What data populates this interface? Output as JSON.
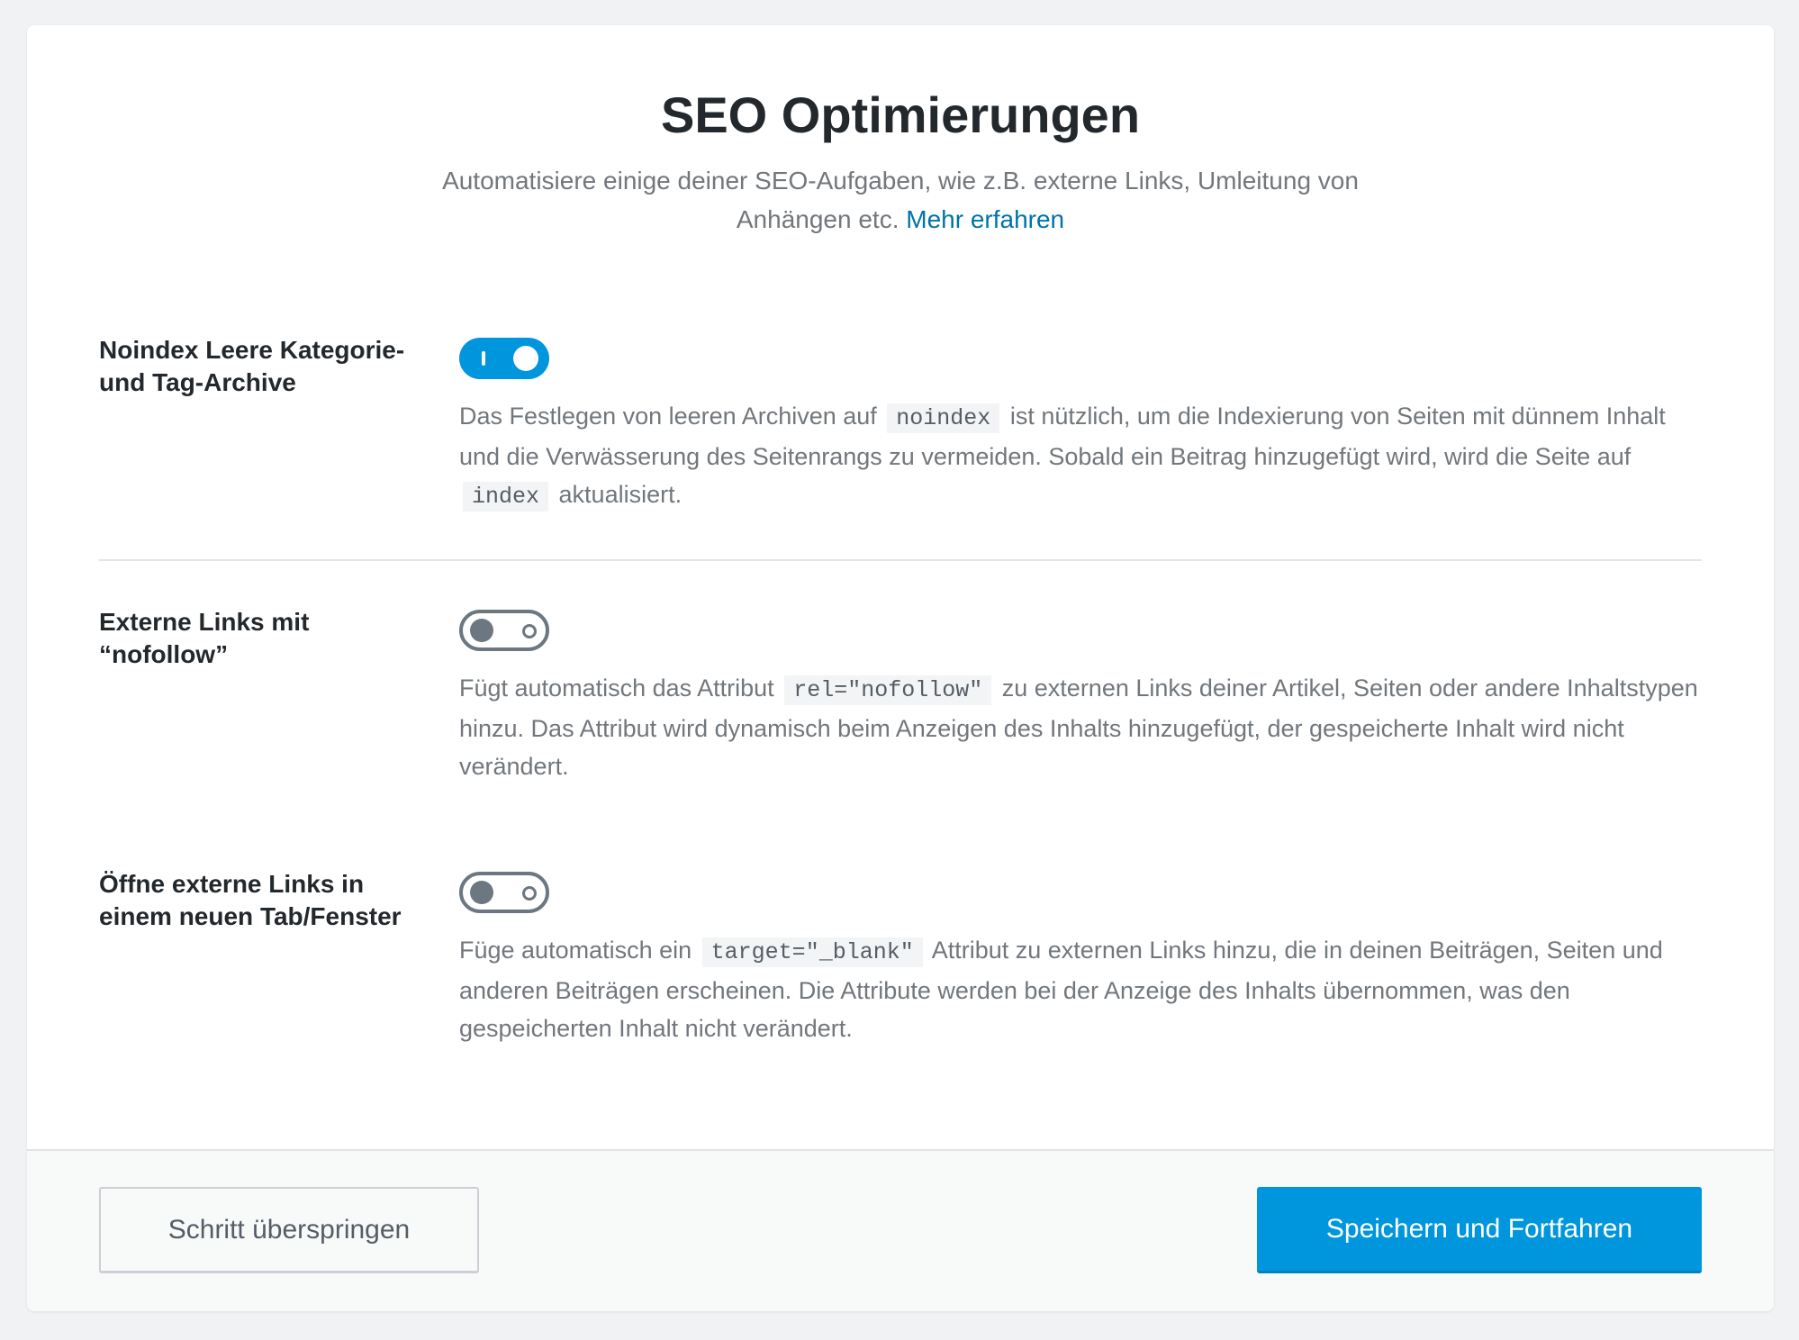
{
  "header": {
    "title": "SEO Optimierungen",
    "subtitle": "Automatisiere einige deiner SEO-Aufgaben, wie z.B. externe Links, Umleitung von Anhängen etc.",
    "learn_more_link": "Mehr erfahren"
  },
  "settings": [
    {
      "label_line1": "Noindex Leere Kategorie-",
      "label_line2": "und Tag-Archive",
      "enabled": true,
      "desc_part1": "Das Festlegen von leeren Archiven auf",
      "desc_code1": "noindex",
      "desc_part2": "ist nützlich, um die Indexierung von Seiten mit dünnem Inhalt und die Verwässerung des Seitenrangs zu vermeiden. Sobald ein Beitrag hinzugefügt wird, wird die Seite auf",
      "desc_code2": "index",
      "desc_part3": "aktualisiert."
    },
    {
      "label_line1": "Externe Links mit",
      "label_line2": "“nofollow”",
      "enabled": false,
      "desc_part1": "Fügt automatisch das Attribut",
      "desc_code1": "rel=\"nofollow\"",
      "desc_part2": "zu externen Links deiner Artikel, Seiten oder andere Inhaltstypen hinzu. Das Attribut wird dynamisch beim Anzeigen des Inhalts hinzugefügt, der gespeicherte Inhalt wird nicht verändert."
    },
    {
      "label_line1": "Öffne externe Links in",
      "label_line2": "einem neuen Tab/Fenster",
      "enabled": false,
      "desc_part1": "Füge automatisch ein",
      "desc_code1": "target=\"_blank\"",
      "desc_part2": "Attribut zu externen Links hinzu, die in deinen Beiträgen, Seiten und anderen Beiträgen erscheinen. Die Attribute werden bei der Anzeige des Inhalts übernommen, was den gespeicherten Inhalt nicht verändert."
    }
  ],
  "footer": {
    "skip_label": "Schritt überspringen",
    "save_label": "Speichern und Fortfahren"
  },
  "colors": {
    "accent": "#0096dd",
    "link": "#0073aa",
    "toggle_off": "#6c7781"
  }
}
